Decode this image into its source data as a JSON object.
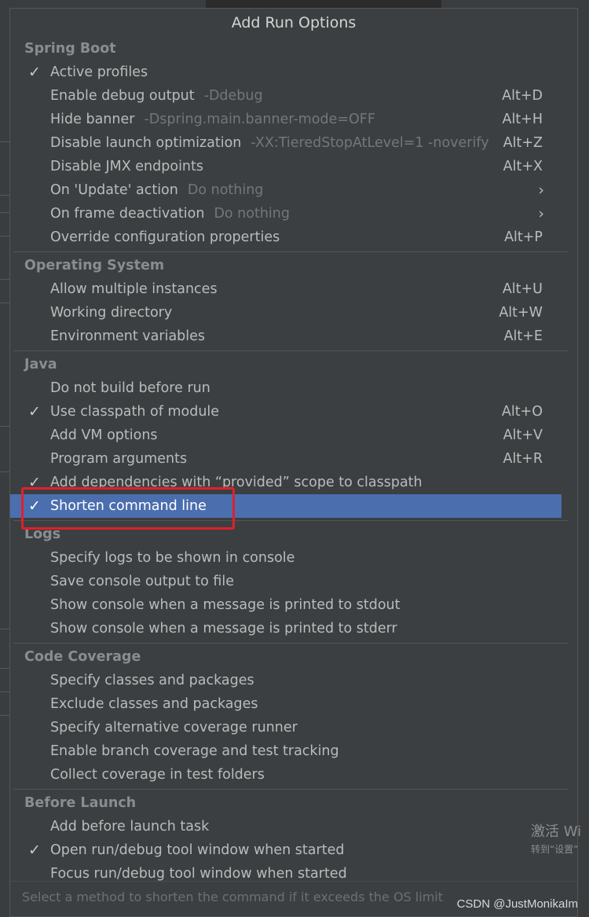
{
  "popup": {
    "title": "Add Run Options",
    "sections": [
      {
        "header": "Spring Boot",
        "items": [
          {
            "label": "Active profiles",
            "checked": true,
            "hint": "",
            "shortcut": "",
            "submenu": false
          },
          {
            "label": "Enable debug output",
            "checked": false,
            "hint": "-Ddebug",
            "shortcut": "Alt+D",
            "submenu": false
          },
          {
            "label": "Hide banner",
            "checked": false,
            "hint": "-Dspring.main.banner-mode=OFF",
            "shortcut": "Alt+H",
            "submenu": false
          },
          {
            "label": "Disable launch optimization",
            "checked": false,
            "hint": "-XX:TieredStopAtLevel=1 -noverify",
            "shortcut": "Alt+Z",
            "submenu": false
          },
          {
            "label": "Disable JMX endpoints",
            "checked": false,
            "hint": "",
            "shortcut": "Alt+X",
            "submenu": false
          },
          {
            "label": "On 'Update' action",
            "checked": false,
            "hint": "Do nothing",
            "shortcut": "",
            "submenu": true
          },
          {
            "label": "On frame deactivation",
            "checked": false,
            "hint": "Do nothing",
            "shortcut": "",
            "submenu": true
          },
          {
            "label": "Override configuration properties",
            "checked": false,
            "hint": "",
            "shortcut": "Alt+P",
            "submenu": false
          }
        ]
      },
      {
        "header": "Operating System",
        "items": [
          {
            "label": "Allow multiple instances",
            "checked": false,
            "hint": "",
            "shortcut": "Alt+U",
            "submenu": false
          },
          {
            "label": "Working directory",
            "checked": false,
            "hint": "",
            "shortcut": "Alt+W",
            "submenu": false
          },
          {
            "label": "Environment variables",
            "checked": false,
            "hint": "",
            "shortcut": "Alt+E",
            "submenu": false
          }
        ]
      },
      {
        "header": "Java",
        "items": [
          {
            "label": "Do not build before run",
            "checked": false,
            "hint": "",
            "shortcut": "",
            "submenu": false
          },
          {
            "label": "Use classpath of module",
            "checked": true,
            "hint": "",
            "shortcut": "Alt+O",
            "submenu": false
          },
          {
            "label": "Add VM options",
            "checked": false,
            "hint": "",
            "shortcut": "Alt+V",
            "submenu": false
          },
          {
            "label": "Program arguments",
            "checked": false,
            "hint": "",
            "shortcut": "Alt+R",
            "submenu": false
          },
          {
            "label": "Add dependencies with “provided” scope to classpath",
            "checked": true,
            "hint": "",
            "shortcut": "",
            "submenu": false
          },
          {
            "label": "Shorten command line",
            "checked": true,
            "hint": "",
            "shortcut": "",
            "submenu": false,
            "selected": true
          }
        ]
      },
      {
        "header": "Logs",
        "items": [
          {
            "label": "Specify logs to be shown in console",
            "checked": false,
            "hint": "",
            "shortcut": "",
            "submenu": false
          },
          {
            "label": "Save console output to file",
            "checked": false,
            "hint": "",
            "shortcut": "",
            "submenu": false
          },
          {
            "label": "Show console when a message is printed to stdout",
            "checked": false,
            "hint": "",
            "shortcut": "",
            "submenu": false
          },
          {
            "label": "Show console when a message is printed to stderr",
            "checked": false,
            "hint": "",
            "shortcut": "",
            "submenu": false
          }
        ]
      },
      {
        "header": "Code Coverage",
        "items": [
          {
            "label": "Specify classes and packages",
            "checked": false,
            "hint": "",
            "shortcut": "",
            "submenu": false
          },
          {
            "label": "Exclude classes and packages",
            "checked": false,
            "hint": "",
            "shortcut": "",
            "submenu": false
          },
          {
            "label": "Specify alternative coverage runner",
            "checked": false,
            "hint": "",
            "shortcut": "",
            "submenu": false
          },
          {
            "label": "Enable branch coverage and test tracking",
            "checked": false,
            "hint": "",
            "shortcut": "",
            "submenu": false
          },
          {
            "label": "Collect coverage in test folders",
            "checked": false,
            "hint": "",
            "shortcut": "",
            "submenu": false
          }
        ]
      },
      {
        "header": "Before Launch",
        "items": [
          {
            "label": "Add before launch task",
            "checked": false,
            "hint": "",
            "shortcut": "",
            "submenu": false
          },
          {
            "label": "Open run/debug tool window when started",
            "checked": true,
            "hint": "",
            "shortcut": "",
            "submenu": false
          },
          {
            "label": "Focus run/debug tool window when started",
            "checked": false,
            "hint": "",
            "shortcut": "",
            "submenu": false
          }
        ]
      }
    ],
    "status_text": "Select a method to shorten the command if it exceeds the OS limit"
  },
  "overlay": {
    "windows_activate": "激活 Wi",
    "windows_activate_sub": "转到“设置”",
    "watermark": "CSDN @JustMonikaIm"
  },
  "colors": {
    "popup_bg": "#3c3f41",
    "selection": "#4b6eaf",
    "annotation_box": "#e0202a"
  },
  "icons": {
    "check": "✓",
    "submenu": "›"
  }
}
